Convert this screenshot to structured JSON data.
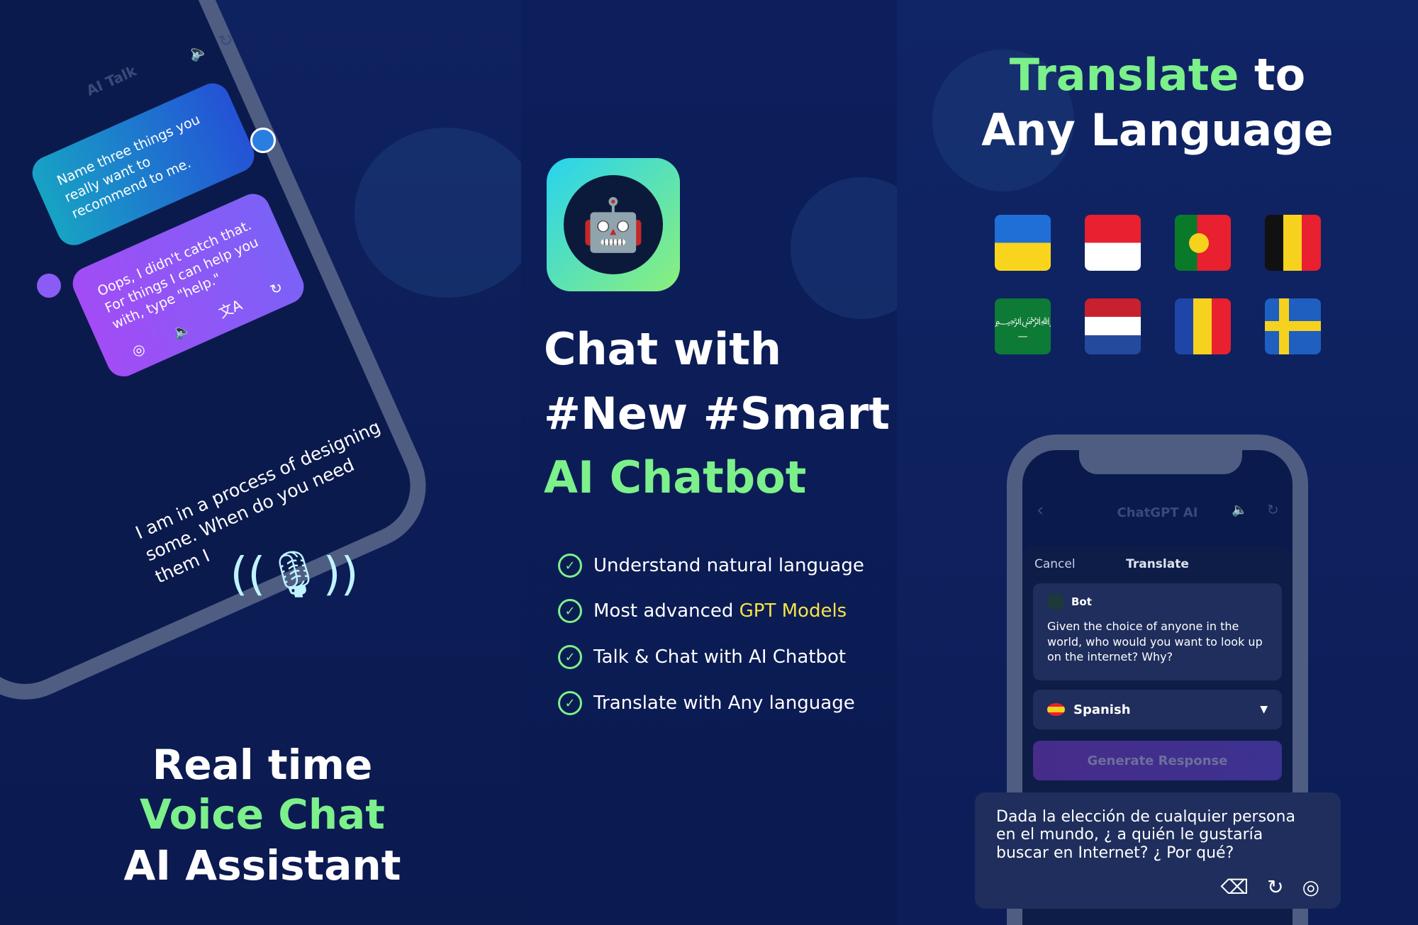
{
  "left_panel": {
    "phone": {
      "header_title": "AI Talk",
      "user_message": "Name three things you really want to recommend to me.",
      "bot_message": "Oops, I didn't catch that. For things I can help you with, type \"help.\"",
      "transcript": "I am in a process of designing some. When do you need them I",
      "icons": [
        "speaker-icon",
        "refresh-icon",
        "user-avatar-icon",
        "bot-avatar-icon",
        "copy-icon",
        "translate-icon",
        "microphone-icon"
      ]
    },
    "headline": {
      "line1": "Real time",
      "line2": "Voice Chat",
      "line3": "AI Assistant"
    }
  },
  "middle_panel": {
    "headline": {
      "line1": "Chat with",
      "line2": "#New #Smart",
      "line3": "AI Chatbot"
    },
    "features": [
      {
        "text": "Understand natural language",
        "highlight": ""
      },
      {
        "text": "Most advanced ",
        "highlight": "GPT Models"
      },
      {
        "text": "Talk & Chat with AI Chatbot",
        "highlight": ""
      },
      {
        "text": "Translate with Any language",
        "highlight": ""
      }
    ]
  },
  "right_panel": {
    "headline": {
      "highlight": "Translate",
      "rest": " to",
      "line2": "Any Language"
    },
    "flags": [
      "Ukraine",
      "Indonesia",
      "Portugal",
      "Belgium",
      "Saudi Arabia",
      "Netherlands",
      "Romania",
      "Sweden"
    ],
    "phone": {
      "header_title": "ChatGPT AI",
      "cancel_label": "Cancel",
      "sheet_title": "Translate",
      "bot_name": "Bot",
      "bot_message": "Given the choice of anyone in the world, who would you want to look up on the internet? Why?",
      "language_selected": "Spanish",
      "generate_label": "Generate Response"
    },
    "result_text": "Dada la elección de cualquier persona en el mundo, ¿ a quién le gustaría buscar en Internet? ¿ Por qué?"
  },
  "colors": {
    "accent_green": "#7cf08a",
    "accent_yellow": "#f7e24a",
    "background": "#0c1d55",
    "button_purple": "#3f2b86"
  }
}
